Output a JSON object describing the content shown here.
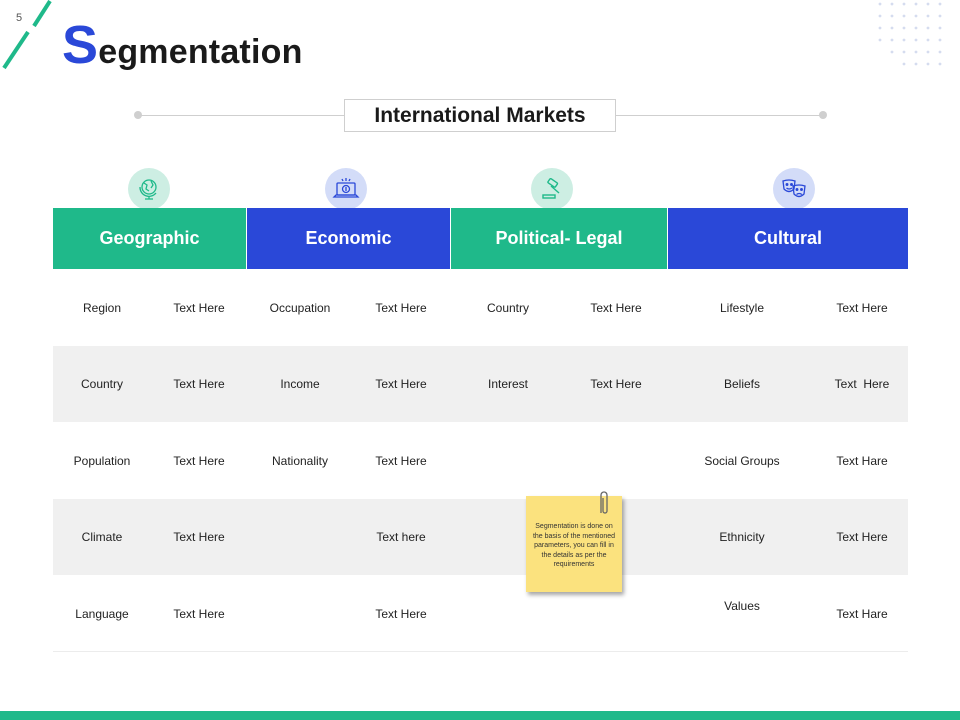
{
  "slide": {
    "page_number": "5",
    "title_initial": "S",
    "title_rest": "egmentation",
    "subtitle": "International Markets"
  },
  "colors": {
    "green": "#1fb98a",
    "blue": "#2a48d8",
    "row_gray": "#f0f0f0",
    "note_yellow": "#fbe27e"
  },
  "columns": [
    {
      "label": "Geographic",
      "color": "green",
      "icon": "globe-icon"
    },
    {
      "label": "Economic",
      "color": "blue",
      "icon": "laptop-dollar-icon"
    },
    {
      "label": "Political- Legal",
      "color": "green",
      "icon": "gavel-icon"
    },
    {
      "label": "Cultural",
      "color": "blue",
      "icon": "theater-masks-icon"
    }
  ],
  "rows": [
    [
      "Region",
      "Text Here",
      "Occupation",
      "Text Here",
      "Country",
      "Text Here",
      "Lifestyle",
      "Text Here"
    ],
    [
      "Country",
      "Text Here",
      "Income",
      "Text Here",
      "Interest",
      "Text Here",
      "Beliefs",
      "Text  Here"
    ],
    [
      "Population",
      "Text Here",
      "Nationality",
      "Text Here",
      "",
      "",
      "Social Groups",
      "Text Hare"
    ],
    [
      "Climate",
      "Text Here",
      "",
      "Text here",
      "",
      "",
      "Ethnicity",
      "Text Here"
    ],
    [
      "Language",
      "Text Here",
      "",
      "Text Here",
      "",
      "",
      "Values",
      "Text Hare"
    ]
  ],
  "sticky_note": {
    "text": "Segmentation  is done on the basis of the mentioned  parameters, you can fill in the details as per the requirements"
  }
}
